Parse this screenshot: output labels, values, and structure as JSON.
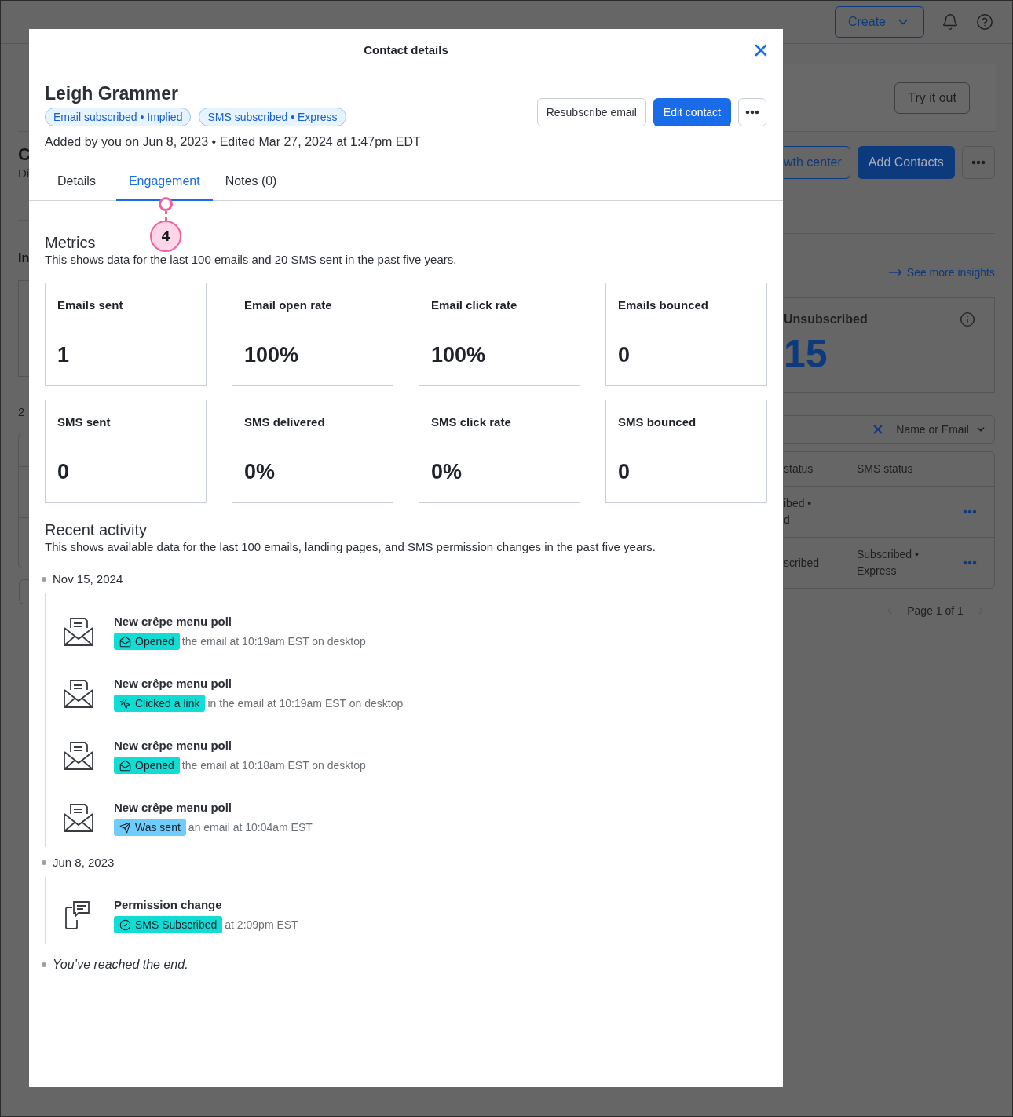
{
  "background": {
    "top_bar": {
      "create_button": "Create"
    },
    "left": {
      "heading": "C",
      "subheading": "Di",
      "section": "In",
      "count": "2"
    },
    "right": {
      "try_button": "Try it out",
      "growth_button": "wth center",
      "add_button": "Add Contacts",
      "insights_link": "See more insights",
      "stat": {
        "label": "Unsubscribed",
        "value": "15"
      },
      "search_scope": "Name or Email",
      "table": {
        "columns": [
          "status",
          "SMS status"
        ],
        "rows": [
          {
            "status": [
              "ibed •",
              "d"
            ]
          },
          {
            "status": [
              "scribed"
            ],
            "sms_status": [
              "Subscribed •",
              "Express"
            ]
          }
        ]
      },
      "pagination": "Page 1 of 1"
    }
  },
  "modal": {
    "title": "Contact details",
    "contact": {
      "name": "Leigh Grammer",
      "badges": [
        "Email subscribed • Implied",
        "SMS subscribed • Express"
      ],
      "meta": "Added by you on Jun 8, 2023 • Edited Mar 27, 2024 at 1:47pm EDT"
    },
    "actions": {
      "resubscribe": "Resubscribe email",
      "edit": "Edit contact"
    },
    "tabs": [
      {
        "label": "Details",
        "selected": false
      },
      {
        "label": "Engagement",
        "selected": true
      },
      {
        "label": "Notes (0)",
        "selected": false
      }
    ],
    "annotation": {
      "label": "4"
    },
    "metrics": {
      "title": "Metrics",
      "description": "This shows data for the last 100 emails and 20 SMS sent in the past five years.",
      "cards": [
        {
          "label": "Emails sent",
          "value": "1"
        },
        {
          "label": "Email open rate",
          "value": "100%"
        },
        {
          "label": "Email click rate",
          "value": "100%"
        },
        {
          "label": "Emails bounced",
          "value": "0"
        },
        {
          "label": "SMS sent",
          "value": "0"
        },
        {
          "label": "SMS delivered",
          "value": "0%"
        },
        {
          "label": "SMS click rate",
          "value": "0%"
        },
        {
          "label": "SMS bounced",
          "value": "0"
        }
      ]
    },
    "recent_activity": {
      "title": "Recent activity",
      "description": "This shows available data for the last 100 emails, landing pages, and SMS permission changes in the past five years.",
      "groups": [
        {
          "date": "Nov 15, 2024",
          "items": [
            {
              "kind": "email",
              "title": "New crêpe menu poll",
              "badge": {
                "kind": "opened",
                "label": "Opened",
                "color": "#12ddd4"
              },
              "detail": "the email at 10:19am EST on desktop"
            },
            {
              "kind": "email",
              "title": "New crêpe menu poll",
              "badge": {
                "kind": "clicked",
                "label": "Clicked a link",
                "color": "#12ddd4"
              },
              "detail": "in the email at 10:19am EST on desktop"
            },
            {
              "kind": "email",
              "title": "New crêpe menu poll",
              "badge": {
                "kind": "opened",
                "label": "Opened",
                "color": "#12ddd4"
              },
              "detail": "the email at 10:18am EST on desktop"
            },
            {
              "kind": "email",
              "title": "New crêpe menu poll",
              "badge": {
                "kind": "sent",
                "label": "Was sent",
                "color": "#6fcdfd"
              },
              "detail": "an email at 10:04am EST"
            }
          ]
        },
        {
          "date": "Jun 8, 2023",
          "items": [
            {
              "kind": "sms",
              "title": "Permission change",
              "badge": {
                "kind": "subscribed",
                "label": "SMS Subscribed",
                "color": "#12ddd4"
              },
              "detail": "at 2:09pm EST"
            }
          ]
        }
      ],
      "end_text": "You’ve reached the end."
    }
  }
}
